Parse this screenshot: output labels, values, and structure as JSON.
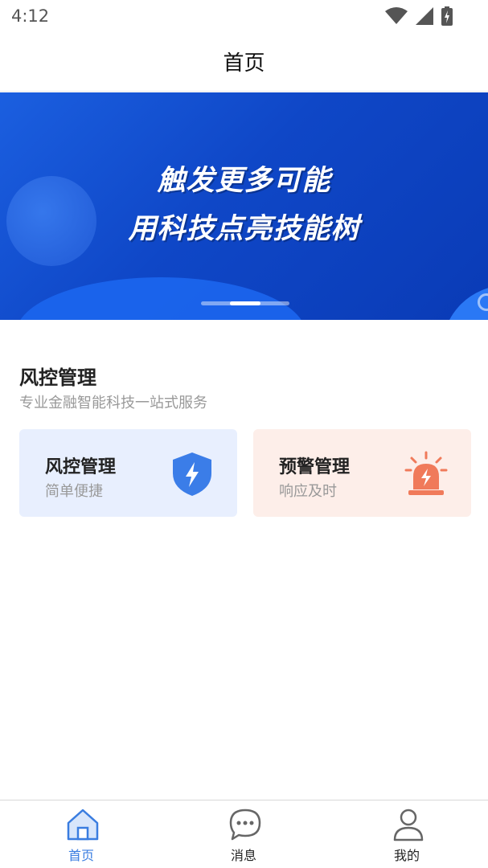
{
  "status_bar": {
    "time": "4:12"
  },
  "header": {
    "title": "首页"
  },
  "banner": {
    "line1": "触发更多可能",
    "line2": "用科技点亮技能树",
    "slide_count": 3,
    "active_slide": 2
  },
  "section": {
    "title": "风控管理",
    "subtitle": "专业金融智能科技一站式服务"
  },
  "cards": [
    {
      "title": "风控管理",
      "subtitle": "简单便捷",
      "icon": "shield-lightning-icon",
      "bg": "#e8effe",
      "icon_color": "#3b7de8"
    },
    {
      "title": "预警管理",
      "subtitle": "响应及时",
      "icon": "alarm-siren-icon",
      "bg": "#fdeee9",
      "icon_color": "#f07a5a"
    }
  ],
  "bottom_nav": {
    "items": [
      {
        "label": "首页",
        "icon": "home-icon",
        "active": true
      },
      {
        "label": "消息",
        "icon": "chat-bubble-icon",
        "active": false
      },
      {
        "label": "我的",
        "icon": "user-icon",
        "active": false
      }
    ]
  },
  "colors": {
    "accent": "#3a7de0",
    "banner_blue": "#0f47c7"
  }
}
